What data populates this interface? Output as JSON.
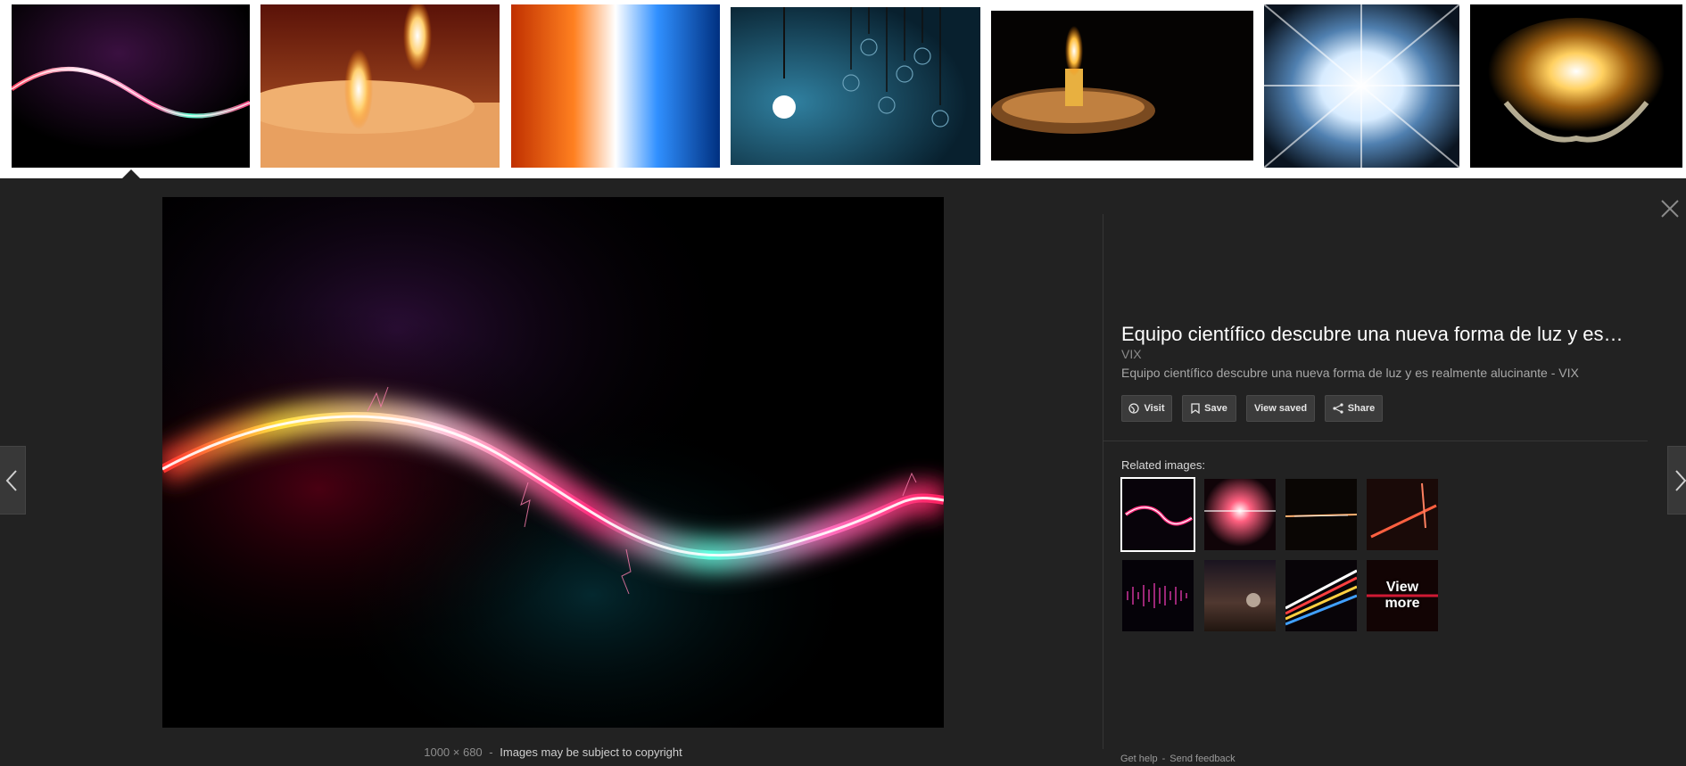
{
  "thumbnails": [
    {
      "name": "light-wave"
    },
    {
      "name": "candles"
    },
    {
      "name": "orange-blue-burst"
    },
    {
      "name": "light-bulbs"
    },
    {
      "name": "candle-dish"
    },
    {
      "name": "white-starburst"
    },
    {
      "name": "hands-holding-light"
    }
  ],
  "image_meta": {
    "dimensions": "1000 × 680",
    "separator": "-",
    "copyright": "Images may be subject to copyright"
  },
  "panel": {
    "title": "Equipo científico descubre una nueva forma de luz y es…",
    "source": "VIX",
    "description": "Equipo científico descubre una nueva forma de luz y es realmente alucinante - VIX"
  },
  "buttons": {
    "visit": "Visit",
    "save": "Save",
    "view_saved": "View saved",
    "share": "Share"
  },
  "related": {
    "label": "Related images:",
    "view_more": "View\nmore"
  },
  "footer": {
    "help": "Get help",
    "separator": "-",
    "feedback": "Send feedback"
  },
  "colors": {
    "viewer_background": "#222222",
    "strip_background": "#ffffff",
    "button_background": "#3b3b3b"
  }
}
